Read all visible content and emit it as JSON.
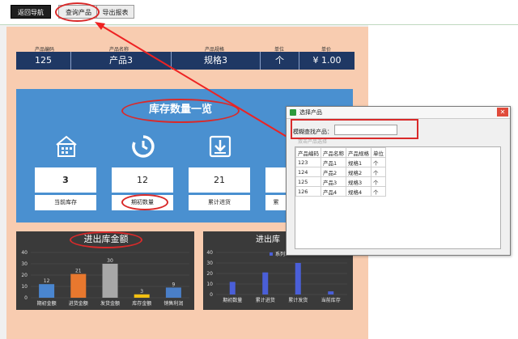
{
  "toolbar": {
    "back_label": "返回导航",
    "query_label": "查询产品",
    "export_label": "导出报表"
  },
  "header": {
    "labels": [
      "产品编码",
      "产品名称",
      "产品规格",
      "单位",
      "单价"
    ],
    "values": [
      "125",
      "产品3",
      "规格3",
      "个",
      "¥ 1.00"
    ]
  },
  "inventory": {
    "title": "库存数量一览",
    "cards": [
      {
        "value": "3",
        "label": "当前库存",
        "icon": "warehouse-icon"
      },
      {
        "value": "12",
        "label": "期初数量",
        "icon": "cycle-icon"
      },
      {
        "value": "21",
        "label": "累计进货",
        "icon": "download-icon"
      },
      {
        "value": "",
        "label": "累",
        "icon": "box-icon"
      }
    ]
  },
  "chart_data": [
    {
      "type": "bar",
      "title": "进出库金额",
      "categories": [
        "期初金额",
        "进货金额",
        "发货金额",
        "库存金额",
        "销售利润"
      ],
      "values": [
        12,
        21,
        30,
        3,
        9
      ],
      "ylim": [
        0,
        40
      ],
      "yticks": [
        0,
        10,
        20,
        30,
        40
      ],
      "colors": [
        "#4a86d0",
        "#e8782e",
        "#a8a8a8",
        "#f2c012",
        "#4a7fc8"
      ]
    },
    {
      "type": "bar",
      "title": "进出库",
      "categories": [
        "期初数量",
        "累计进货",
        "累计发货",
        "当前库存"
      ],
      "series": [
        {
          "name": "系列1",
          "values": [
            12,
            21,
            30,
            3
          ]
        }
      ],
      "ylim": [
        0,
        40
      ],
      "yticks": [
        0,
        10,
        20,
        30,
        40
      ],
      "color": "#4a5fd8"
    }
  ],
  "dialog": {
    "title": "选择产品",
    "search_label": "模糊查找产品：",
    "search_value": "",
    "hint": "双击产品选择",
    "columns": [
      "产品编码",
      "产品名称",
      "产品规格",
      "单位"
    ],
    "rows": [
      [
        "123",
        "产品1",
        "规格1",
        "个"
      ],
      [
        "124",
        "产品2",
        "规格2",
        "个"
      ],
      [
        "125",
        "产品3",
        "规格3",
        "个"
      ],
      [
        "126",
        "产品4",
        "规格4",
        "个"
      ]
    ]
  }
}
